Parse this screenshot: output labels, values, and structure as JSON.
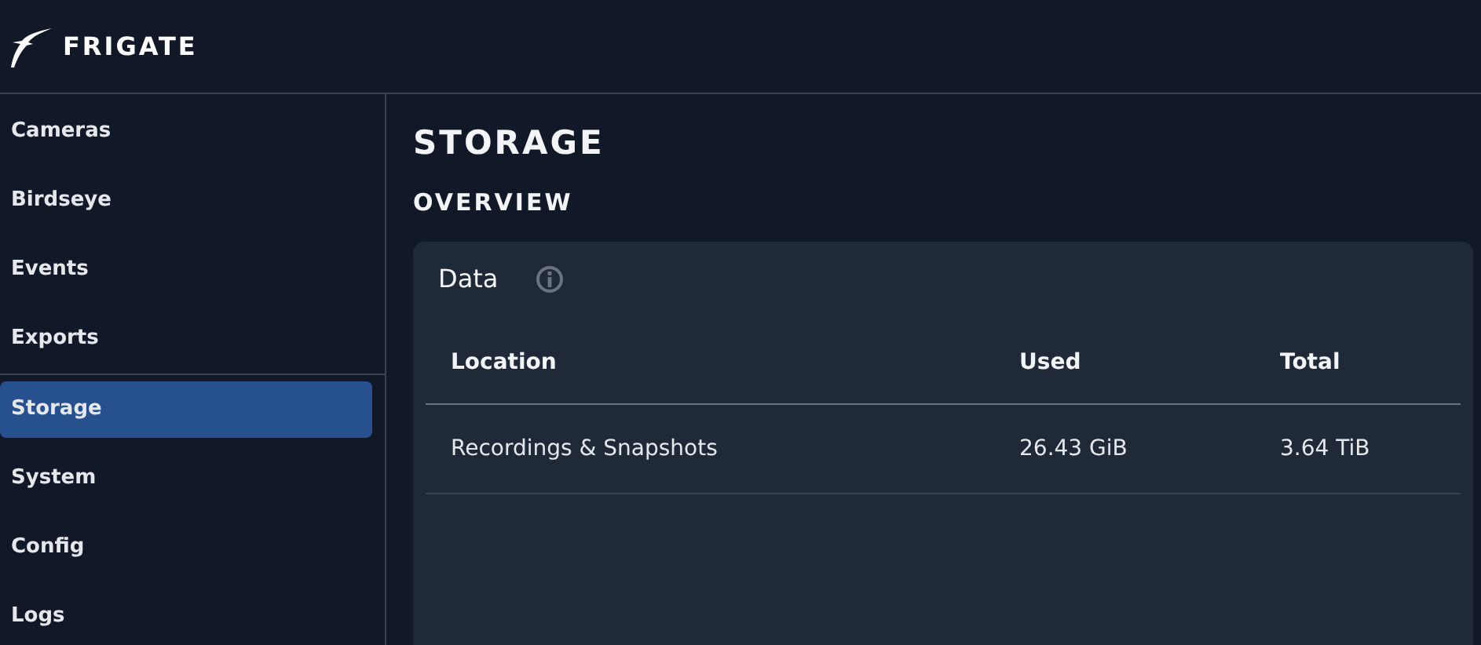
{
  "header": {
    "title": "FRIGATE"
  },
  "sidebar": {
    "groups": [
      {
        "items": [
          {
            "label": "Cameras",
            "selected": false
          },
          {
            "label": "Birdseye",
            "selected": false
          },
          {
            "label": "Events",
            "selected": false
          },
          {
            "label": "Exports",
            "selected": false
          }
        ]
      },
      {
        "items": [
          {
            "label": "Storage",
            "selected": true
          },
          {
            "label": "System",
            "selected": false
          },
          {
            "label": "Config",
            "selected": false
          },
          {
            "label": "Logs",
            "selected": false
          }
        ]
      }
    ]
  },
  "page": {
    "title": "STORAGE",
    "section": "OVERVIEW",
    "card": {
      "title": "Data",
      "table": {
        "columns": [
          "Location",
          "Used",
          "Total"
        ],
        "rows": [
          [
            "Recordings & Snapshots",
            "26.43 GiB",
            "3.64 TiB"
          ]
        ]
      }
    }
  }
}
